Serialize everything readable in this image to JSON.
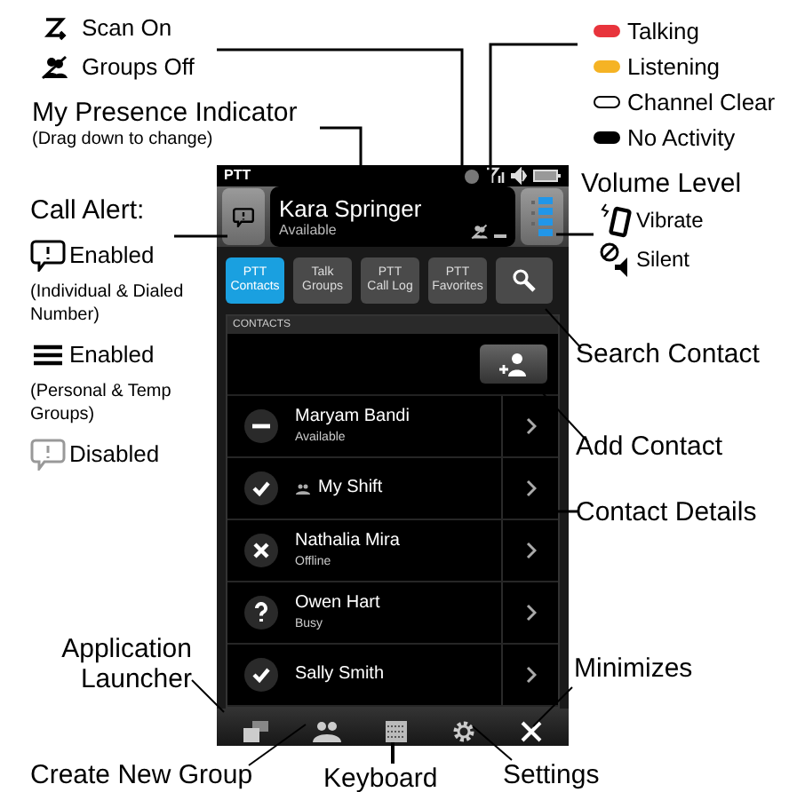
{
  "scan_legend": [
    {
      "kind": "scan",
      "label": "Scan On"
    },
    {
      "kind": "groups_off",
      "label": "Groups Off"
    }
  ],
  "presence_callout": {
    "title": "My Presence Indicator",
    "note": "(Drag down to change)"
  },
  "activity_legend": [
    {
      "kind": "filled",
      "label": "Talking",
      "color": "#e8343c"
    },
    {
      "kind": "filled",
      "label": "Listening",
      "color": "#f5b324"
    },
    {
      "kind": "outline",
      "label": "Channel Clear",
      "color": "#000000"
    },
    {
      "kind": "filled",
      "label": "No Activity",
      "color": "#000000"
    }
  ],
  "volume_callout": {
    "title": "Volume Level",
    "items": [
      {
        "kind": "vibrate",
        "label": "Vibrate"
      },
      {
        "kind": "silent",
        "label": "Silent"
      }
    ]
  },
  "call_alert_callout": {
    "title": "Call Alert:",
    "items": [
      {
        "kind": "alert_enabled",
        "label": "Enabled",
        "note": "(Individual & Dialed Number)"
      },
      {
        "kind": "groups_enabled",
        "label": "Enabled",
        "note": "(Personal & Temp Groups)"
      },
      {
        "kind": "alert_disabled",
        "label": "Disabled"
      }
    ]
  },
  "right_callouts": [
    "Search Contact",
    "Add Contact",
    "Contact Details",
    "Minimizes"
  ],
  "bottom_callouts": [
    "Application Launcher",
    "Create New Group",
    "Keyboard",
    "Settings"
  ],
  "phone": {
    "status_bar": {
      "title": "PTT"
    },
    "my_status": {
      "name": "Kara Springer",
      "presence": "Available"
    },
    "tabs": [
      {
        "label": "PTT\nContacts",
        "selected": true
      },
      {
        "label": "Talk\nGroups",
        "selected": false
      },
      {
        "label": "PTT\nCall Log",
        "selected": false
      },
      {
        "label": "PTT\nFavorites",
        "selected": false
      }
    ],
    "section_header": "CONTACTS",
    "contacts": [
      {
        "kind": "dash",
        "name": "Maryam Bandi",
        "status": "Available",
        "group": false
      },
      {
        "kind": "check",
        "name": "My Shift",
        "group": true
      },
      {
        "kind": "cross",
        "name": "Nathalia Mira",
        "status": "Offline",
        "group": false
      },
      {
        "kind": "question",
        "name": "Owen Hart",
        "status": "Busy",
        "group": false
      },
      {
        "kind": "check",
        "name": "Sally Smith",
        "group": false
      }
    ]
  }
}
